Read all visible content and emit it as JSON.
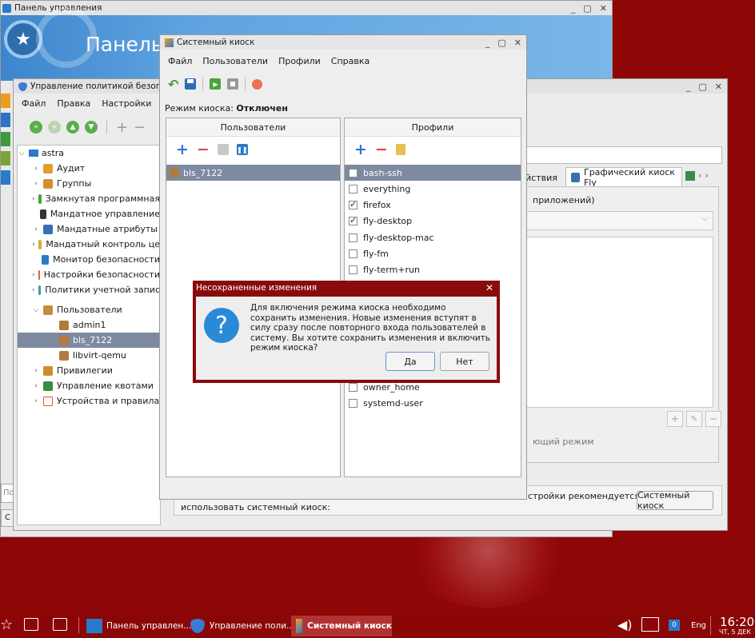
{
  "desktop": {
    "bg": "#8f0606"
  },
  "control_panel": {
    "title": "Панель управления",
    "header": "Панель",
    "search_placeholder": "По",
    "side_btn": "С"
  },
  "policy_window": {
    "title": "Управление политикой безопасности",
    "menu": [
      "Файл",
      "Правка",
      "Настройки",
      "П"
    ],
    "tree": {
      "root": "astra",
      "items": [
        "Аудит",
        "Группы",
        "Замкнутая программная",
        "Мандатное управление",
        "Мандатные атрибуты",
        "Мандатный контроль це",
        "Монитор безопасности",
        "Настройки безопасности",
        "Политики учетной запис",
        "Пользователи"
      ],
      "users": [
        "admin1",
        "bls_7122",
        "libvirt-qemu"
      ],
      "after": [
        "Привилегии",
        "Управление квотами",
        "Устройства и правила"
      ]
    },
    "tabs": [
      "йствия",
      "Графический киоск Fly"
    ],
    "apps_label": "приложений)",
    "mode_text": "ющий режим",
    "footer_text_1": "стройки рекомендуется",
    "footer_text_2": "использовать системный киоск:",
    "footer_button": "Системный киоск"
  },
  "kiosk_window": {
    "title": "Системный киоск",
    "menu": [
      "Файл",
      "Пользователи",
      "Профили",
      "Справка"
    ],
    "status_label": "Режим киоска:",
    "status_value": "Отключен",
    "users_header": "Пользователи",
    "profiles_header": "Профили",
    "users": [
      "bls_7122"
    ],
    "profiles_top": [
      {
        "name": "bash-ssh",
        "checked": false
      },
      {
        "name": "everything",
        "checked": false
      },
      {
        "name": "firefox",
        "checked": true
      },
      {
        "name": "fly-desktop",
        "checked": true
      },
      {
        "name": "fly-desktop-mac",
        "checked": false
      },
      {
        "name": "fly-fm",
        "checked": false
      },
      {
        "name": "fly-term+run",
        "checked": false
      }
    ],
    "profiles_bottom": [
      {
        "name": "owner_home",
        "checked": false
      },
      {
        "name": "systemd-user",
        "checked": false
      }
    ]
  },
  "dialog": {
    "title": "Несохраненные изменения",
    "message": "Для включения режима киоска необходимо сохранить изменения. Новые изменения вступят в силу сразу после повторного входа пользователей в систему. Вы хотите сохранить изменения и включить режим киоска?",
    "yes": "Да",
    "no": "Нет"
  },
  "taskbar": {
    "tasks": [
      "Панель управлен...",
      "Управление поли...",
      "Системный киоск"
    ],
    "workspace": "0",
    "lang": "Eng",
    "time": "16:20",
    "date": "ЧТ, 5 ДЕК"
  }
}
